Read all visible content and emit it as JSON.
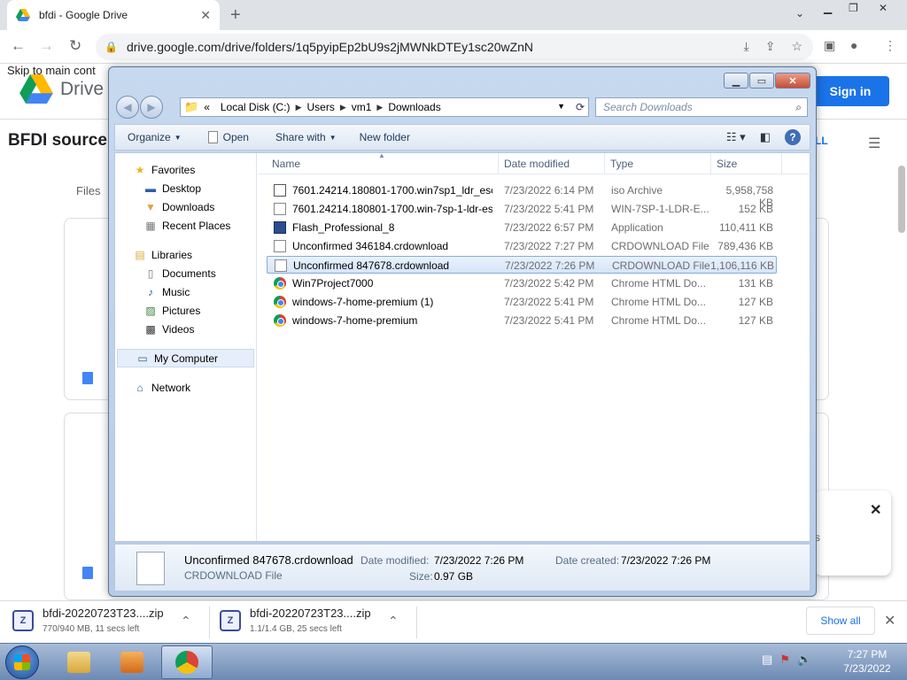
{
  "browser": {
    "tab_title": "bfdi - Google Drive",
    "tab_close": "✕",
    "new_tab": "+",
    "url": "drive.google.com/drive/folders/1q5pyipEp2bU9s2jMWNkDTEy1sc20wZnN"
  },
  "drive": {
    "skip_link": "Skip to main cont",
    "logo_label": "Drive",
    "sign_in": "Sign in",
    "folder_title": "BFDI source",
    "files_label": "Files",
    "all_link": "LL",
    "toast_close": "✕",
    "toast_text": "s"
  },
  "explorer": {
    "breadcrumb_prefix": "«",
    "breadcrumb": [
      "Local Disk (C:)",
      "Users",
      "vm1",
      "Downloads"
    ],
    "search_placeholder": "Search Downloads",
    "toolbar": {
      "organize": "Organize",
      "open": "Open",
      "share_with": "Share with",
      "new_folder": "New folder",
      "help": "?"
    },
    "nav": {
      "favorites": "Favorites",
      "desktop": "Desktop",
      "downloads": "Downloads",
      "recent_places": "Recent Places",
      "libraries": "Libraries",
      "documents": "Documents",
      "music": "Music",
      "pictures": "Pictures",
      "videos": "Videos",
      "my_computer": "My Computer",
      "network": "Network"
    },
    "columns": {
      "name": "Name",
      "date_modified": "Date modified",
      "type": "Type",
      "size": "Size"
    },
    "files": [
      {
        "icon": "iso",
        "name": "7601.24214.180801-1700.win7sp1_ldr_escr...",
        "date": "7/23/2022 6:14 PM",
        "type": "iso Archive",
        "size": "5,958,758 KB"
      },
      {
        "icon": "doc",
        "name": "7601.24214.180801-1700.win-7sp-1-ldr-es...",
        "date": "7/23/2022 5:41 PM",
        "type": "WIN-7SP-1-LDR-E...",
        "size": "152 KB"
      },
      {
        "icon": "app",
        "name": "Flash_Professional_8",
        "date": "7/23/2022 6:57 PM",
        "type": "Application",
        "size": "110,411 KB"
      },
      {
        "icon": "doc",
        "name": "Unconfirmed 346184.crdownload",
        "date": "7/23/2022 7:27 PM",
        "type": "CRDOWNLOAD File",
        "size": "789,436 KB"
      },
      {
        "icon": "doc",
        "name": "Unconfirmed 847678.crdownload",
        "date": "7/23/2022 7:26 PM",
        "type": "CRDOWNLOAD File",
        "size": "1,106,116 KB"
      },
      {
        "icon": "chrome",
        "name": "Win7Project7000",
        "date": "7/23/2022 5:42 PM",
        "type": "Chrome HTML Do...",
        "size": "131 KB"
      },
      {
        "icon": "chrome",
        "name": "windows-7-home-premium (1)",
        "date": "7/23/2022 5:41 PM",
        "type": "Chrome HTML Do...",
        "size": "127 KB"
      },
      {
        "icon": "chrome",
        "name": "windows-7-home-premium",
        "date": "7/23/2022 5:41 PM",
        "type": "Chrome HTML Do...",
        "size": "127 KB"
      }
    ],
    "details": {
      "name": "Unconfirmed 847678.crdownload",
      "type": "CRDOWNLOAD File",
      "date_modified_label": "Date modified:",
      "date_modified": "7/23/2022 7:26 PM",
      "date_created_label": "Date created:",
      "date_created": "7/23/2022 7:26 PM",
      "size_label": "Size:",
      "size": "0.97 GB"
    }
  },
  "downloads": [
    {
      "name": "bfdi-20220723T23....zip",
      "status": "770/940 MB, 11 secs left"
    },
    {
      "name": "bfdi-20220723T23....zip",
      "status": "1.1/1.4 GB, 25 secs left"
    }
  ],
  "shelf": {
    "show_all": "Show all",
    "close": "✕"
  },
  "taskbar": {
    "time": "7:27 PM",
    "date": "7/23/2022"
  },
  "colors": {
    "drive_blue": "#1a73e8",
    "selection": "#d5e5f8"
  }
}
